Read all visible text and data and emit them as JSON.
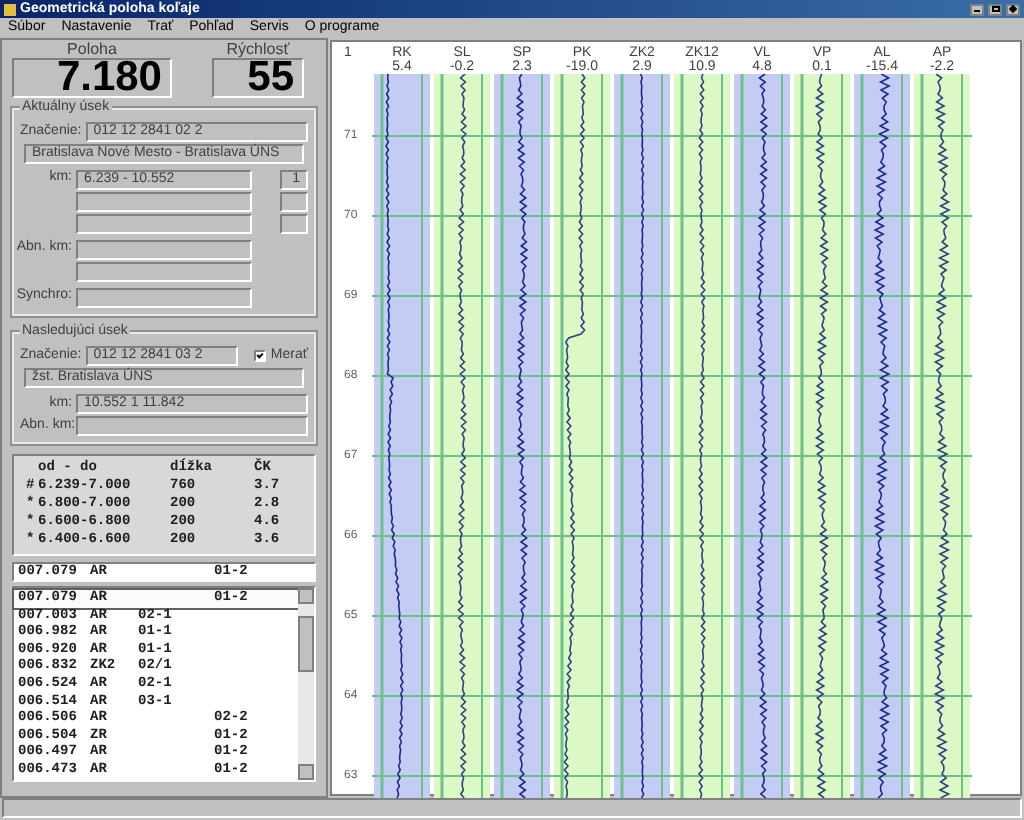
{
  "window": {
    "title": "Geometrická poloha koľaje"
  },
  "menu": [
    "Súbor",
    "Nastavenie",
    "Trať",
    "Pohľad",
    "Servis",
    "O programe"
  ],
  "position": {
    "label": "Poloha",
    "value": "7.180"
  },
  "speed": {
    "label": "Rýchlosť",
    "value": "55"
  },
  "current_section": {
    "title": "Aktuálny úsek",
    "marking_label": "Značenie:",
    "marking": "012 12 2841 02 2",
    "name": "Bratislava Nové Mesto - Bratislava ÚNS",
    "km_label": "km:",
    "km": "6.239 - 10.552",
    "side_value": "1",
    "abn_km_label": "Abn. km:",
    "synchro_label": "Synchro:"
  },
  "next_section": {
    "title": "Nasledujúci úsek",
    "marking_label": "Značenie:",
    "marking": "012 12 2841 03 2",
    "measure": {
      "label": "Merať",
      "checked": true
    },
    "name": "žst. Bratislava ÚNS",
    "km_label": "km:",
    "km": "10.552 1 11.842",
    "abn_km_label": "Abn. km:"
  },
  "segments": {
    "columns": [
      "od - do",
      "dĺžka",
      "ČK"
    ],
    "rows": [
      {
        "marker": "#",
        "range": "6.239-7.000",
        "length": "760",
        "ck": "3.7"
      },
      {
        "marker": "*",
        "range": "6.800-7.000",
        "length": "200",
        "ck": "2.8"
      },
      {
        "marker": "*",
        "range": "6.600-6.800",
        "length": "200",
        "ck": "4.6"
      },
      {
        "marker": "*",
        "range": "6.400-6.600",
        "length": "200",
        "ck": "3.6"
      }
    ]
  },
  "current_event": {
    "km": "007.079",
    "code": "AR",
    "column_4": "01-2"
  },
  "events": [
    {
      "km": "007.079",
      "code": "AR",
      "column_4": "01-2",
      "selected": true
    },
    {
      "km": "007.003",
      "code": "AR",
      "column_3": "02-1",
      "selected": false
    },
    {
      "km": "006.982",
      "code": "AR",
      "column_3": "01-1",
      "selected": false
    },
    {
      "km": "006.920",
      "code": "AR",
      "column_3": "01-1",
      "selected": false
    },
    {
      "km": "006.832",
      "code": "ZK2",
      "column_3": "02/1",
      "selected": false
    },
    {
      "km": "006.524",
      "code": "AR",
      "column_3": "02-1",
      "selected": false
    },
    {
      "km": "006.514",
      "code": "AR",
      "column_3": "03-1",
      "selected": false
    },
    {
      "km": "006.506",
      "code": "AR",
      "column_4": "02-2",
      "selected": false
    },
    {
      "km": "006.504",
      "code": "ZR",
      "column_4": "01-2",
      "selected": false
    },
    {
      "km": "006.497",
      "code": "AR",
      "column_4": "01-2",
      "selected": false
    },
    {
      "km": "006.473",
      "code": "AR",
      "column_4": "01-2",
      "selected": false
    }
  ],
  "chart": {
    "corner_label": "1",
    "channels": [
      {
        "name": "RK",
        "value": "5.4",
        "color": "#c4ccf4"
      },
      {
        "name": "SL",
        "value": "-0.2",
        "color": "#dcf8c4"
      },
      {
        "name": "SP",
        "value": "2.3",
        "color": "#c4ccf4"
      },
      {
        "name": "PK",
        "value": "-19.0",
        "color": "#dcf8c4"
      },
      {
        "name": "ZK2",
        "value": "2.9",
        "color": "#c4ccf4"
      },
      {
        "name": "ZK12",
        "value": "10.9",
        "color": "#dcf8c4"
      },
      {
        "name": "VL",
        "value": "4.8",
        "color": "#c4ccf4"
      },
      {
        "name": "VP",
        "value": "0.1",
        "color": "#dcf8c4"
      },
      {
        "name": "AL",
        "value": "-15.4",
        "color": "#c4ccf4"
      },
      {
        "name": "AP",
        "value": "-2.2",
        "color": "#dcf8c4"
      }
    ],
    "row_labels": [
      "71",
      "70",
      "69",
      "68",
      "67",
      "66",
      "65",
      "64",
      "63"
    ]
  }
}
